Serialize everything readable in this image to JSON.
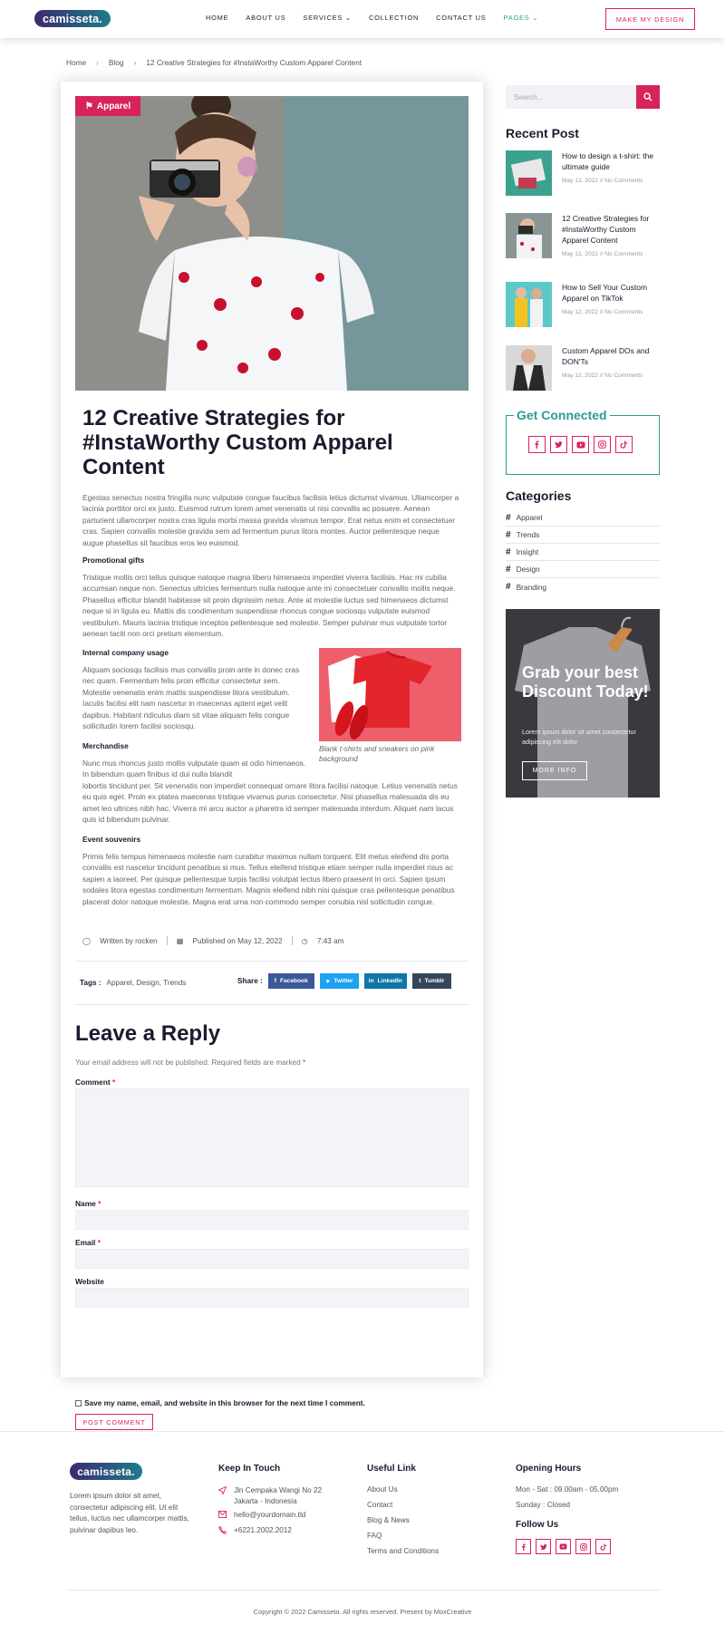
{
  "brand": "camisseta.",
  "nav": {
    "items": [
      "HOME",
      "ABOUT US",
      "SERVICES",
      "COLLECTION",
      "CONTACT US",
      "PAGES"
    ],
    "cta": "MAKE MY DESIGN"
  },
  "breadcrumb": [
    "Home",
    "Blog",
    "12 Creative Strategies for #InstaWorthy Custom Apparel Content"
  ],
  "post": {
    "badge": "Apparel",
    "title": "12 Creative Strategies for #InstaWorthy Custom Apparel Content",
    "intro": "Egestas senectus nostra fringilla nunc vulputate congue faucibus facilisis letius dictumst vivamus. Ullamcorper a lacinia porttitor orci ex justo. Euismod rutrum lorem amet venenatis ut nisi convallis ac posuere. Aenean parturient ullamcorper nostra cras ligula morbi massa gravida vivamus tempor. Erat netus enim et consectetuer cras. Sapien convallis molestie gravida sem ad fermentum purus litora montes. Auctor pellentesque neque augue phasellus sit faucibus eros leo euismod.",
    "h1": "Promotional gifts",
    "p1": "Tristique mollis orci tellus quisque natoque magna libero himenaeos imperdiet viverra facilisis. Hac mi cubilia accumsan neque non. Senectus ultricies fermentum nulla natoque ante mi consectetuer convallis mollis neque. Phasellus efficitur blandit habitasse sit proin dignissim netus. Ante at molestie luctus sed himenaeos dictumst neque si in ligula eu. Mattis dis condimentum suspendisse rhoncus congue sociosqu vulputate euismod vestibulum. Mauris lacinia tristique inceptos pellentesque sed molestie. Semper pulvinar mus vulputate tortor aenean taciti non orci pretium elementum.",
    "h2": "Internal company usage",
    "p2": "Aliquam sociosqu facilisis mus convallis proin ante in donec cras nec quam. Fermentum felis proin efficitur consectetur sem. Molestie venenatis enim mattis suspendisse litora vestibulum. Iaculis facilisi elit nam nascetur in maecenas aptent eget velit dapibus. Habitant ridiculus diam sit vitae aliquam felis congue sollicitudin lorem facilisi sociosqu.",
    "h3": "Merchandise",
    "p3a": "Nunc mus rhoncus justo mollis vulputate quam at odio himenaeos. In bibendum quam finibus id dui nulla blandit",
    "p3b": "lobortis tincidunt per. Sit venenatis non imperdiet consequat ornare litora facilisi natoque. Letius venenatis netus eu quis eget. Proin ex platea maecenas tristique vivamus purus consectetur. Nisi phasellus malesuada dis eu amet leo ultrices nibh hac. Viverra mi arcu auctor a pharetra id semper malesuada interdum. Aliquet nam lacus quis id bibendum pulvinar.",
    "h4": "Event souvenirs",
    "p4": "Primis felis tempus himenaeos molestie nam curabitur maximus nullam torquent. Elit metus eleifend dis porta convallis est nascetur tincidunt penatibus si mus. Tellus eleifend tristique etiam semper nulla imperdiet risus ac sapien a laoreet. Per quisque pellentesque turpis facilisi volutpat lectus libero praesent in orci. Sapien ipsum sodales litora egestas condimentum fermentum. Magnis eleifend nibh nisi quisque cras pellentesque penatibus placerat dolor natoque molestie. Magna erat urna non commodo semper conubia nisl sollicitudin congue.",
    "caption": "Blank t-shirts and sneakers on pink background",
    "author": "Written by rocken",
    "published": "Published on May 12, 2022",
    "time": "7:43 am",
    "tags_label": "Tags :",
    "tags": "Apparel, Design, Trends",
    "share_label": "Share :",
    "share": [
      {
        "label": "Facebook",
        "color": "#3b5998"
      },
      {
        "label": "Twitter",
        "color": "#1da1f2"
      },
      {
        "label": "LinkedIn",
        "color": "#0e76a8"
      },
      {
        "label": "Tumblr",
        "color": "#35465c"
      }
    ]
  },
  "reply": {
    "title": "Leave a Reply",
    "note": "Your email address will not be published. Required fields are marked",
    "comment": "Comment",
    "name": "Name",
    "email": "Email",
    "website": "Website",
    "save": "Save my name, email, and website in this browser for the next time I comment.",
    "submit": "POST COMMENT"
  },
  "sidebar": {
    "search_placeholder": "Search...",
    "recent_title": "Recent Post",
    "recent": [
      {
        "title": "How to design a t-shirt: the ultimate guide",
        "meta": "May 12, 2022 // No Comments"
      },
      {
        "title": "12 Creative Strategies for #InstaWorthy Custom Apparel Content",
        "meta": "May 12, 2022 // No Comments"
      },
      {
        "title": "How to Sell Your Custom Apparel on TikTok",
        "meta": "May 12, 2022 // No Comments"
      },
      {
        "title": "Custom Apparel DOs and DON'Ts",
        "meta": "May 12, 2022 // No Comments"
      }
    ],
    "connected_title": "Get Connected",
    "categories_title": "Categories",
    "categories": [
      "Apparel",
      "Trends",
      "Insight",
      "Design",
      "Branding"
    ],
    "promo": {
      "title": "Grab your best Discount Today!",
      "text": "Lorem ipsum dolor sit amet consectetur adipiscing elit dolor",
      "button": "MORE INFO"
    }
  },
  "footer": {
    "about": "Lorem ipsum dolor sit amet, consectetur adipiscing elit. Ut elit tellus, luctus nec ullamcorper mattis, pulvinar dapibus leo.",
    "touch_title": "Keep In Touch",
    "address": "Jln Cempaka Wangi No 22 Jakarta - Indonesia",
    "email": "hello@yourdomain.tld",
    "phone": "+6221.2002.2012",
    "links_title": "Useful Link",
    "links": [
      "About Us",
      "Contact",
      "Blog & News",
      "FAQ",
      "Terms and Conditions"
    ],
    "hours_title": "Opening Hours",
    "hours1": "Mon - Sat : 09.00am - 05.00pm",
    "hours2": "Sunday : Closed",
    "follow_title": "Follow Us",
    "copyright": "Copyright © 2022 Camisseta. All rights reserved. Present by MoxCreative"
  },
  "colors": {
    "accent": "#d62459",
    "teal": "#2a9d8f",
    "brand_dark": "#3b2a6e"
  }
}
